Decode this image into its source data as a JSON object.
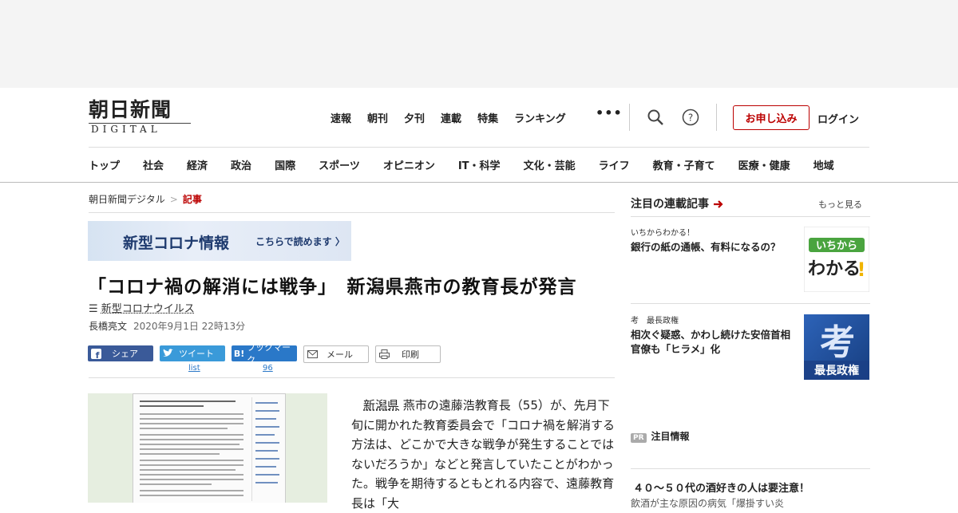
{
  "logo": {
    "jp": "朝日新聞",
    "en": "DIGITAL"
  },
  "nav_top": [
    "速報",
    "朝刊",
    "夕刊",
    "連載",
    "特集",
    "ランキング"
  ],
  "nav_more": "•••",
  "header_actions": {
    "subscribe": "お申し込み",
    "login": "ログイン"
  },
  "categories": [
    "トップ",
    "社会",
    "経済",
    "政治",
    "国際",
    "スポーツ",
    "オピニオン",
    "IT・科学",
    "文化・芸能",
    "ライフ",
    "教育・子育て",
    "医療・健康",
    "地域"
  ],
  "breadcrumb": {
    "home": "朝日新聞デジタル",
    "sep": ">",
    "current": "記事"
  },
  "banner": {
    "title": "新型コロナ情報",
    "link": "こちらで読めます"
  },
  "article": {
    "headline": "「コロナ禍の解消には戦争」　新潟県燕市の教育長が発言",
    "tag": "新型コロナウイルス",
    "author": "長橋亮文",
    "date": "2020年9月1日 22時13分",
    "body_link": "新潟県",
    "body_rest": " 燕市の遠藤浩教育長（55）が、先月下旬に開かれた教育委員会で「コロナ禍を解消する方法は、どこかで大きな戦争が発生することではないだろうか」などと発言していたことがわかった。戦争を期待するともとれる内容で、遠藤教育長は「大"
  },
  "share": {
    "facebook": "シェア",
    "twitter": "ツイート",
    "twitter_count": "list",
    "hatena": "ブックマーク",
    "hatena_count": "96",
    "mail": "メール",
    "print": "印刷"
  },
  "sidebar": {
    "heading": "注目の連載記事",
    "more": "もっと見る",
    "items": [
      {
        "kicker": "いちからわかる！",
        "title": "銀行の紙の通帳、有料になるの？",
        "thumb": "いちから\nわかる!"
      },
      {
        "kicker": "考　最長政権",
        "title": "相次ぐ疑惑、かわし続けた安倍首相　官僚も「ヒラメ」化",
        "thumb": "最長政権"
      }
    ],
    "pr_badge": "PR",
    "pr_heading": "注目情報",
    "pr_title": "４０～５０代の酒好きの人は要注意！",
    "pr_sub": "飲酒が主な原因の病気「爆掛すい炎"
  },
  "colors": {
    "accent": "#bb0000",
    "facebook": "#3a5a99",
    "twitter": "#3a9ad9",
    "hatena": "#2a78c8"
  }
}
